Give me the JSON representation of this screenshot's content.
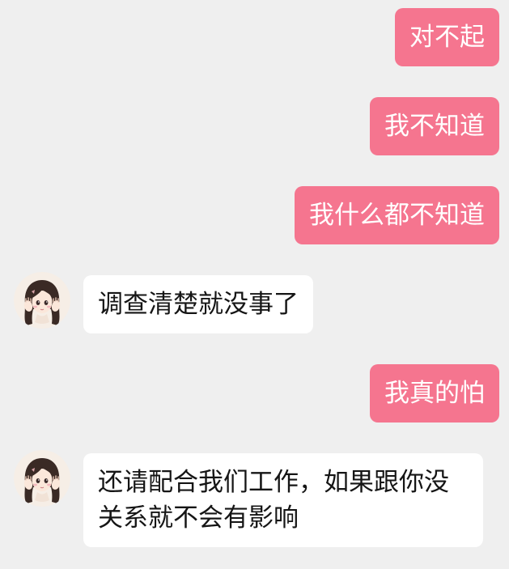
{
  "theme": {
    "background": "#efefef",
    "outgoing_bubble": "#f5758f",
    "incoming_bubble": "#ffffff",
    "outgoing_text": "#ffffff",
    "incoming_text": "#151515"
  },
  "messages": [
    {
      "direction": "outgoing",
      "text": "对不起"
    },
    {
      "direction": "outgoing",
      "text": "我不知道"
    },
    {
      "direction": "outgoing",
      "text": "我什么都不知道"
    },
    {
      "direction": "incoming",
      "avatar": "girl-illustration-avatar",
      "text": "调查清楚就没事了"
    },
    {
      "direction": "outgoing",
      "text": "我真的怕"
    },
    {
      "direction": "incoming",
      "avatar": "girl-illustration-avatar",
      "text": "还请配合我们工作，如果跟你没关系就不会有影响"
    }
  ]
}
